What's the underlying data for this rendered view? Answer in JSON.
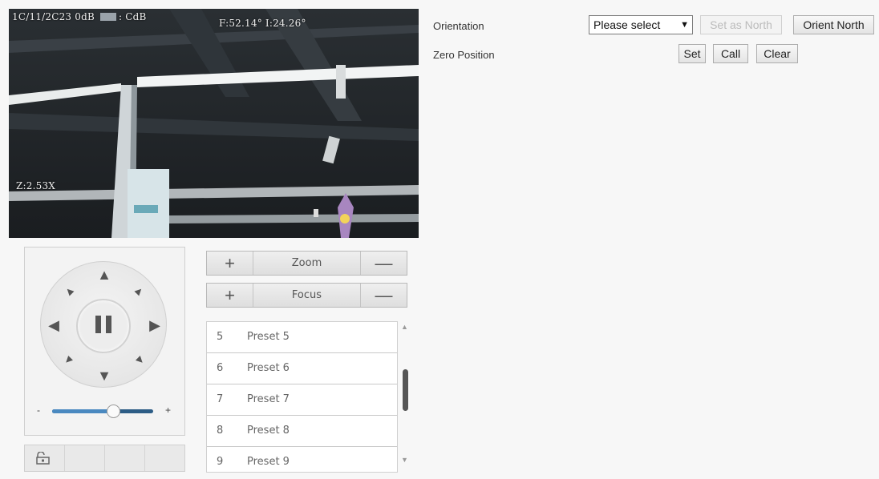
{
  "video": {
    "osd_date": "1C/11/2C23 0dB",
    "osd_db": "CdB",
    "osd_angles": "F:52.14° I:24.26°",
    "osd_zoom": "Z:2.53X"
  },
  "ptz": {
    "speed_min": "-",
    "speed_max": "+",
    "speed_level": 0.6,
    "icons": {
      "up": "arrow-up-icon",
      "down": "arrow-down-icon",
      "left": "arrow-left-icon",
      "right": "arrow-right-icon",
      "upleft": "arrow-up-left-icon",
      "upright": "arrow-up-right-icon",
      "downleft": "arrow-down-left-icon",
      "downright": "arrow-down-right-icon",
      "pause": "pause-icon",
      "lock": "lock-icon"
    }
  },
  "zoom": {
    "label": "Zoom",
    "plus": "+",
    "minus": "—"
  },
  "focus": {
    "label": "Focus",
    "plus": "+",
    "minus": "—"
  },
  "presets": [
    {
      "num": "5",
      "name": "Preset 5"
    },
    {
      "num": "6",
      "name": "Preset 6"
    },
    {
      "num": "7",
      "name": "Preset 7"
    },
    {
      "num": "8",
      "name": "Preset 8"
    },
    {
      "num": "9",
      "name": "Preset 9"
    }
  ],
  "settings": {
    "orientation_label": "Orientation",
    "orientation_value": "Please select",
    "set_as_north": "Set as North",
    "orient_north": "Orient North",
    "zero_position_label": "Zero Position",
    "set": "Set",
    "call": "Call",
    "clear": "Clear"
  },
  "colors": {
    "speed_track": "#2d5d86",
    "page_bg": "#f7f7f7"
  }
}
